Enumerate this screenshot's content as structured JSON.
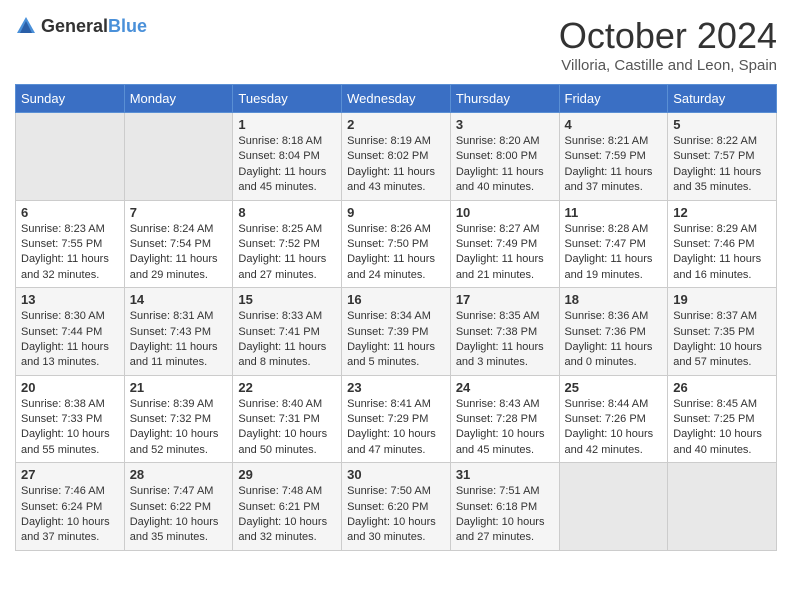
{
  "header": {
    "logo_general": "General",
    "logo_blue": "Blue",
    "month_title": "October 2024",
    "location": "Villoria, Castille and Leon, Spain"
  },
  "calendar": {
    "day_headers": [
      "Sunday",
      "Monday",
      "Tuesday",
      "Wednesday",
      "Thursday",
      "Friday",
      "Saturday"
    ],
    "weeks": [
      [
        {
          "day": "",
          "info": ""
        },
        {
          "day": "",
          "info": ""
        },
        {
          "day": "1",
          "info": "Sunrise: 8:18 AM\nSunset: 8:04 PM\nDaylight: 11 hours and 45 minutes."
        },
        {
          "day": "2",
          "info": "Sunrise: 8:19 AM\nSunset: 8:02 PM\nDaylight: 11 hours and 43 minutes."
        },
        {
          "day": "3",
          "info": "Sunrise: 8:20 AM\nSunset: 8:00 PM\nDaylight: 11 hours and 40 minutes."
        },
        {
          "day": "4",
          "info": "Sunrise: 8:21 AM\nSunset: 7:59 PM\nDaylight: 11 hours and 37 minutes."
        },
        {
          "day": "5",
          "info": "Sunrise: 8:22 AM\nSunset: 7:57 PM\nDaylight: 11 hours and 35 minutes."
        }
      ],
      [
        {
          "day": "6",
          "info": "Sunrise: 8:23 AM\nSunset: 7:55 PM\nDaylight: 11 hours and 32 minutes."
        },
        {
          "day": "7",
          "info": "Sunrise: 8:24 AM\nSunset: 7:54 PM\nDaylight: 11 hours and 29 minutes."
        },
        {
          "day": "8",
          "info": "Sunrise: 8:25 AM\nSunset: 7:52 PM\nDaylight: 11 hours and 27 minutes."
        },
        {
          "day": "9",
          "info": "Sunrise: 8:26 AM\nSunset: 7:50 PM\nDaylight: 11 hours and 24 minutes."
        },
        {
          "day": "10",
          "info": "Sunrise: 8:27 AM\nSunset: 7:49 PM\nDaylight: 11 hours and 21 minutes."
        },
        {
          "day": "11",
          "info": "Sunrise: 8:28 AM\nSunset: 7:47 PM\nDaylight: 11 hours and 19 minutes."
        },
        {
          "day": "12",
          "info": "Sunrise: 8:29 AM\nSunset: 7:46 PM\nDaylight: 11 hours and 16 minutes."
        }
      ],
      [
        {
          "day": "13",
          "info": "Sunrise: 8:30 AM\nSunset: 7:44 PM\nDaylight: 11 hours and 13 minutes."
        },
        {
          "day": "14",
          "info": "Sunrise: 8:31 AM\nSunset: 7:43 PM\nDaylight: 11 hours and 11 minutes."
        },
        {
          "day": "15",
          "info": "Sunrise: 8:33 AM\nSunset: 7:41 PM\nDaylight: 11 hours and 8 minutes."
        },
        {
          "day": "16",
          "info": "Sunrise: 8:34 AM\nSunset: 7:39 PM\nDaylight: 11 hours and 5 minutes."
        },
        {
          "day": "17",
          "info": "Sunrise: 8:35 AM\nSunset: 7:38 PM\nDaylight: 11 hours and 3 minutes."
        },
        {
          "day": "18",
          "info": "Sunrise: 8:36 AM\nSunset: 7:36 PM\nDaylight: 11 hours and 0 minutes."
        },
        {
          "day": "19",
          "info": "Sunrise: 8:37 AM\nSunset: 7:35 PM\nDaylight: 10 hours and 57 minutes."
        }
      ],
      [
        {
          "day": "20",
          "info": "Sunrise: 8:38 AM\nSunset: 7:33 PM\nDaylight: 10 hours and 55 minutes."
        },
        {
          "day": "21",
          "info": "Sunrise: 8:39 AM\nSunset: 7:32 PM\nDaylight: 10 hours and 52 minutes."
        },
        {
          "day": "22",
          "info": "Sunrise: 8:40 AM\nSunset: 7:31 PM\nDaylight: 10 hours and 50 minutes."
        },
        {
          "day": "23",
          "info": "Sunrise: 8:41 AM\nSunset: 7:29 PM\nDaylight: 10 hours and 47 minutes."
        },
        {
          "day": "24",
          "info": "Sunrise: 8:43 AM\nSunset: 7:28 PM\nDaylight: 10 hours and 45 minutes."
        },
        {
          "day": "25",
          "info": "Sunrise: 8:44 AM\nSunset: 7:26 PM\nDaylight: 10 hours and 42 minutes."
        },
        {
          "day": "26",
          "info": "Sunrise: 8:45 AM\nSunset: 7:25 PM\nDaylight: 10 hours and 40 minutes."
        }
      ],
      [
        {
          "day": "27",
          "info": "Sunrise: 7:46 AM\nSunset: 6:24 PM\nDaylight: 10 hours and 37 minutes."
        },
        {
          "day": "28",
          "info": "Sunrise: 7:47 AM\nSunset: 6:22 PM\nDaylight: 10 hours and 35 minutes."
        },
        {
          "day": "29",
          "info": "Sunrise: 7:48 AM\nSunset: 6:21 PM\nDaylight: 10 hours and 32 minutes."
        },
        {
          "day": "30",
          "info": "Sunrise: 7:50 AM\nSunset: 6:20 PM\nDaylight: 10 hours and 30 minutes."
        },
        {
          "day": "31",
          "info": "Sunrise: 7:51 AM\nSunset: 6:18 PM\nDaylight: 10 hours and 27 minutes."
        },
        {
          "day": "",
          "info": ""
        },
        {
          "day": "",
          "info": ""
        }
      ]
    ]
  }
}
